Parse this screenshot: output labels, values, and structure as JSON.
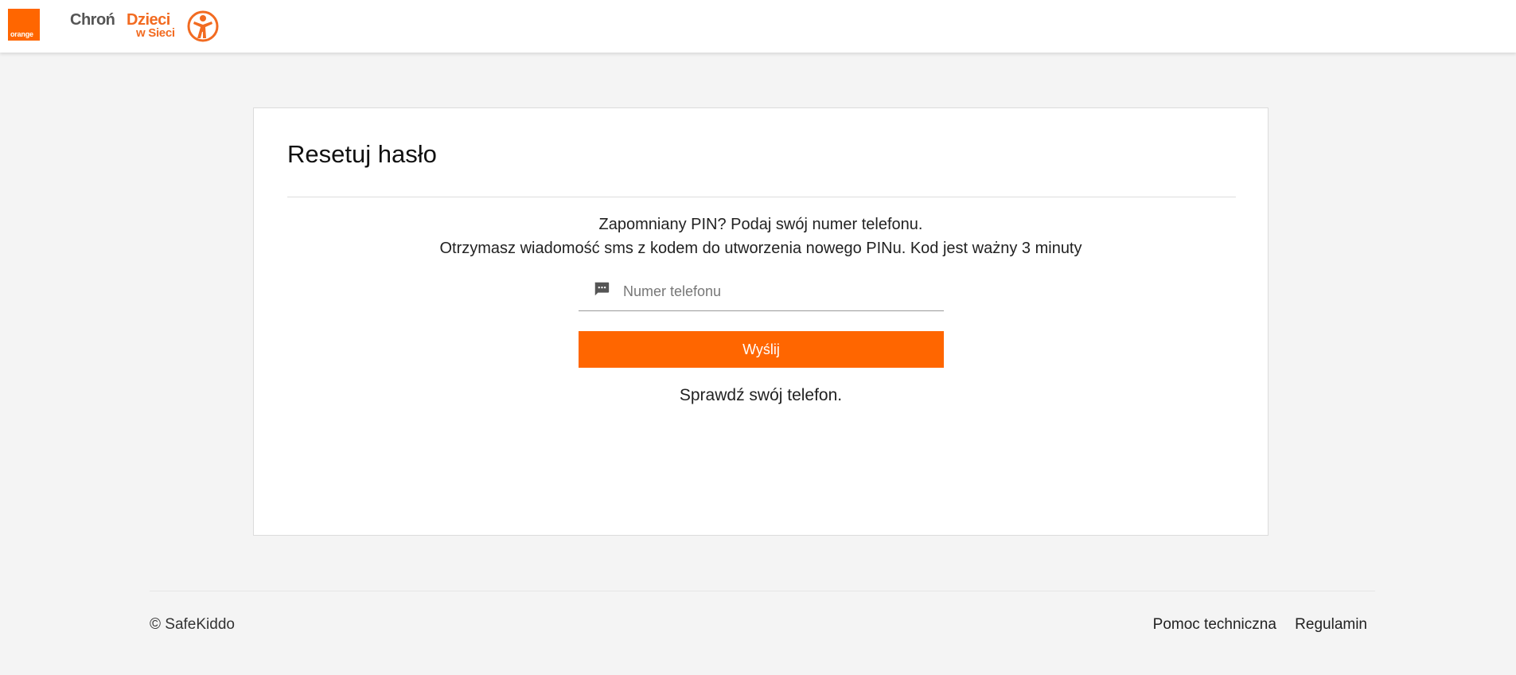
{
  "header": {
    "orange_logo_text": "orange",
    "brand": {
      "line1_part1": "Chroń",
      "line1_part2": "Dzieci",
      "line2": "w Sieci"
    }
  },
  "card": {
    "title": "Resetuj hasło",
    "instruction_line1": "Zapomniany PIN? Podaj swój numer telefonu.",
    "instruction_line2": "Otrzymasz wiadomość sms z kodem do utworzenia nowego PINu. Kod jest ważny 3 minuty",
    "phone_field": {
      "icon": "message-icon",
      "placeholder": "Numer telefonu",
      "value": ""
    },
    "send_button_label": "Wyślij",
    "status_text": "Sprawdź swój telefon."
  },
  "footer": {
    "copyright": "© SafeKiddo",
    "links": [
      {
        "label": "Pomoc techniczna"
      },
      {
        "label": "Regulamin"
      }
    ]
  },
  "colors": {
    "accent": "#ff6600",
    "brand_orange": "#f26b21",
    "background": "#f4f4f4"
  }
}
